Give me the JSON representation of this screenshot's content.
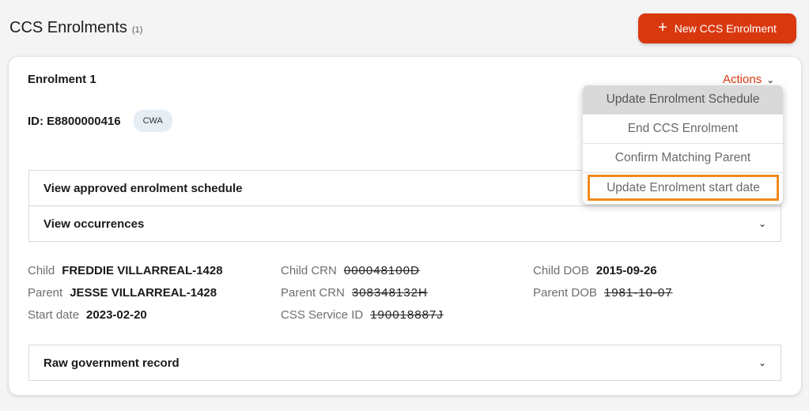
{
  "header": {
    "title": "CCS Enrolments",
    "count": "(1)",
    "new_button_label": "New CCS Enrolment"
  },
  "card": {
    "title": "Enrolment 1",
    "actions_label": "Actions",
    "id_text": "ID: E8800000416",
    "badge": "CWA"
  },
  "actions_menu": {
    "items": [
      "Update Enrolment Schedule",
      "End CCS Enrolment",
      "Confirm Matching Parent",
      "Update Enrolment start date"
    ]
  },
  "sections": {
    "schedule": "View approved enrolment schedule",
    "occurrences": "View occurrences",
    "raw": "Raw government record"
  },
  "details": {
    "child_label": "Child",
    "child_value": "FREDDIE VILLARREAL-1428",
    "parent_label": "Parent",
    "parent_value": "JESSE VILLARREAL-1428",
    "start_label": "Start date",
    "start_value": "2023-02-20",
    "child_crn_label": "Child CRN",
    "child_crn_value": "000048100D",
    "parent_crn_label": "Parent CRN",
    "parent_crn_value": "308348132H",
    "service_id_label": "CSS Service ID",
    "service_id_value": "190018887J",
    "child_dob_label": "Child DOB",
    "child_dob_value": "2015-09-26",
    "parent_dob_label": "Parent DOB",
    "parent_dob_value": "1981-10-07"
  },
  "colors": {
    "accent": "#d9380f",
    "highlight": "#f08a1c"
  }
}
